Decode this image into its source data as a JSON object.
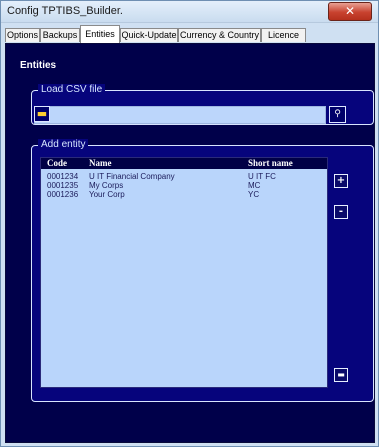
{
  "window": {
    "title": "Config TPTIBS_Builder.",
    "close_label": "✕"
  },
  "tabs": [
    {
      "label": "Options"
    },
    {
      "label": "Backups"
    },
    {
      "label": "Entities"
    },
    {
      "label": "Quick-Update"
    },
    {
      "label": "Currency & Country"
    },
    {
      "label": "Licence"
    }
  ],
  "active_tab": "Entities",
  "panel": {
    "title": "Entities"
  },
  "load_csv": {
    "legend": "Load CSV file",
    "file_value": "",
    "folder_icon": "folder-icon",
    "browse_label": "⚲"
  },
  "add_entity": {
    "legend": "Add entity",
    "columns": {
      "code": "Code",
      "name": "Name",
      "short_name": "Short name"
    },
    "rows": [
      {
        "code": "0001234",
        "name": "U IT Financial Company",
        "short_name": "U IT FC"
      },
      {
        "code": "0001235",
        "name": "My Corps",
        "short_name": "MC"
      },
      {
        "code": "0001236",
        "name": "Your Corp",
        "short_name": "YC"
      }
    ],
    "add_label": "+",
    "remove_label": "-",
    "delete_label": "▬"
  },
  "colors": {
    "panel_bg": "#00004a",
    "group_bg": "#06047c",
    "list_bg": "#b9d5fb",
    "input_bg": "#bcd6fb"
  }
}
